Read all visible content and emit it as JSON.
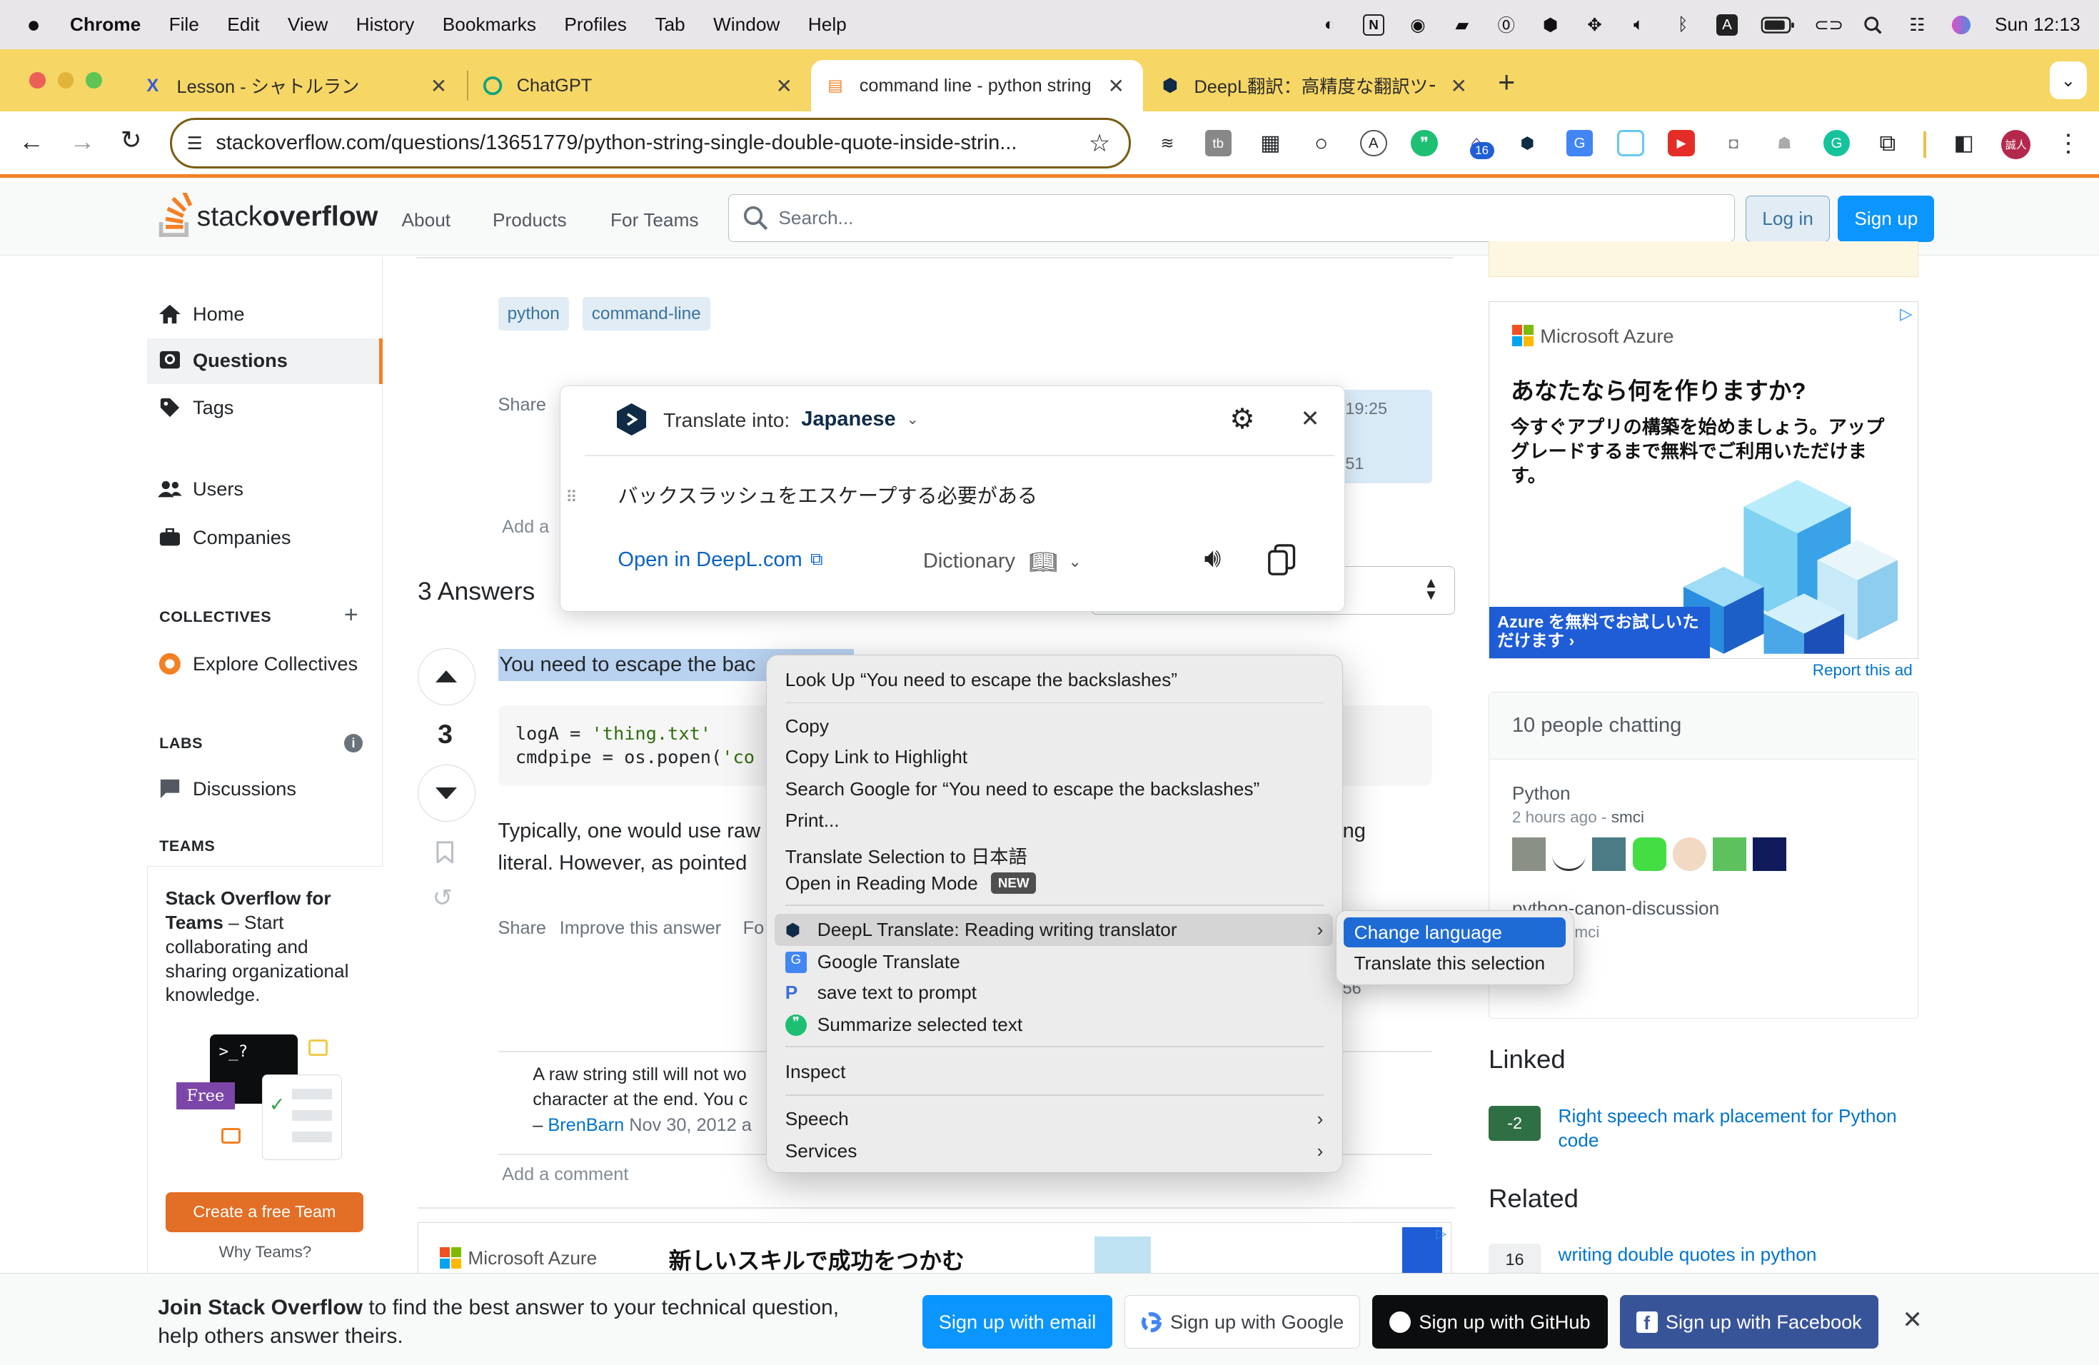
{
  "menubar": {
    "app": "Chrome",
    "items": [
      "File",
      "Edit",
      "View",
      "History",
      "Bookmarks",
      "Profiles",
      "Tab",
      "Window",
      "Help"
    ],
    "clock": "Sun 12:13"
  },
  "tabs": [
    {
      "title": "Lesson - シャトルラン"
    },
    {
      "title": "ChatGPT"
    },
    {
      "title": "command line - python string"
    },
    {
      "title": "DeepL翻訳：高精度な翻訳ツール"
    }
  ],
  "omnibox": {
    "url": "stackoverflow.com/questions/13651779/python-string-single-double-quote-inside-strin..."
  },
  "extensions": {
    "badge": "16",
    "profile": "誠人"
  },
  "so": {
    "logo_a": "stack",
    "logo_b": "overflow",
    "nav": [
      "About",
      "Products",
      "For Teams"
    ],
    "search_placeholder": "Search...",
    "login": "Log in",
    "signup": "Sign up"
  },
  "leftnav": {
    "home": "Home",
    "questions": "Questions",
    "tags": "Tags",
    "users": "Users",
    "companies": "Companies",
    "collectives": "COLLECTIVES",
    "explore": "Explore Collectives",
    "labs": "LABS",
    "discussions": "Discussions",
    "teams": "TEAMS",
    "teams_title": "Stack Overflow for Teams",
    "teams_dash": " – Start collaborating and sharing organizational knowledge.",
    "free": "Free",
    "prompt": ">_?",
    "create_team": "Create a free Team",
    "why_teams": "Why Teams?"
  },
  "question": {
    "tags": [
      "python",
      "command-line"
    ],
    "share": "Share",
    "add_comment_trunc": "Add a",
    "time_a": "19:25",
    "time_b": "51"
  },
  "answers": {
    "count": "3 Answers",
    "vote": "3",
    "highlight": "You need to escape the bac",
    "code_line1_a": "logA = ",
    "code_line1_b": "'thing.txt'",
    "code_line2_a": "cmdpipe = os.popen(",
    "code_line2_b": "'co",
    "body_line1": "Typically, one would use raw",
    "body_line1_end": "ng",
    "body_line2": "literal. However, as pointed",
    "actions": [
      "Share",
      "Improve this answer",
      "Fo"
    ],
    "rep_fragment": "56",
    "comment_line1": "A raw string still will not wo",
    "comment_line2": "character at the end. You c",
    "comment_dash": "–",
    "comment_user": "BrenBarn",
    "comment_date": "Nov 30, 2012 a",
    "add_comment": "Add a comment",
    "sort_placeholder": ""
  },
  "deepl_popup": {
    "label": "Translate into:",
    "language": "Japanese",
    "translation": "バックスラッシュをエスケープする必要がある",
    "open_link": "Open in DeepL.com",
    "dictionary": "Dictionary"
  },
  "context_menu": {
    "items": [
      "Look Up “You need to escape the backslashes”",
      "Copy",
      "Copy Link to Highlight",
      "Search Google for “You need to escape the backslashes”",
      "Print...",
      "Translate Selection to 日本語",
      "Open in Reading Mode",
      "DeepL Translate: Reading  writing translator",
      "Google Translate",
      "save text to prompt",
      "Summarize selected text",
      "Inspect",
      "Speech",
      "Services"
    ],
    "new_badge": "NEW",
    "submenu": [
      "Change language",
      "Translate this selection"
    ]
  },
  "rightbar": {
    "ad_brand": "Microsoft Azure",
    "ad_headline": "あなたなら何を作りますか?",
    "ad_body": "今すぐアプリの構築を始めましょう。アップグレードするまで無料でご利用いただけます。",
    "ad_cta": "Azure を無料でお試しいただけます ›",
    "report_ad": "Report this ad",
    "chat_header": "10 people chatting",
    "chat_room1": "Python",
    "chat_room1_meta_a": "2 hours ago - ",
    "chat_room1_meta_b": "smci",
    "chat_room2": "python-canon-discussion",
    "chat_room2_meta": "t 9:58 - smci",
    "linked_title": "Linked",
    "linked_score": "-2",
    "linked_q": "Right speech mark placement for Python code",
    "related_title": "Related",
    "related_score": "16",
    "related_q": "writing double quotes in python"
  },
  "bottom_ad": {
    "brand": "Microsoft Azure",
    "headline": "新しいスキルで成功をつかむ"
  },
  "banner": {
    "bold": "Join Stack Overflow",
    "text": " to find the best answer to your technical question, help others answer theirs.",
    "email": "Sign up with email",
    "google": "Sign up with Google",
    "github": "Sign up with GitHub",
    "facebook": "Sign up with Facebook"
  },
  "colors": {
    "so_orange": "#f48024",
    "so_blue": "#0a95ff",
    "tab_yellow": "#f6d664",
    "menu_highlight": "#1f6bd6"
  }
}
